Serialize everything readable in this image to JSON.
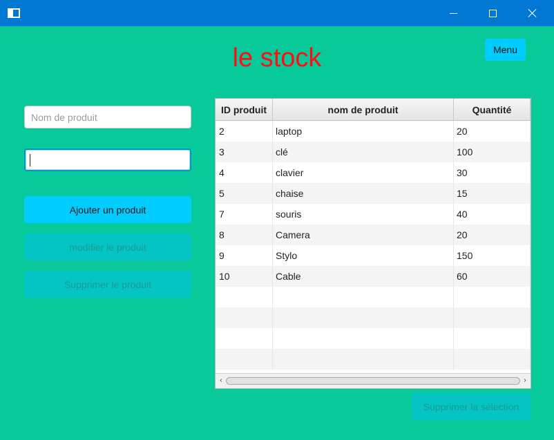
{
  "window": {
    "app_icon": "app-window-icon",
    "controls": [
      "minimize-icon",
      "maximize-icon",
      "close-icon"
    ]
  },
  "header": {
    "title": "le stock",
    "menu_label": "Menu"
  },
  "form": {
    "name_placeholder": "Nom de produit",
    "quantity_value": "",
    "add_label": "Ajouter un produit",
    "edit_label": "modifier le produit",
    "delete_label": "Supprimer le produit"
  },
  "table": {
    "columns": [
      "ID produit",
      "nom de produit",
      "Quantité"
    ],
    "rows": [
      [
        "2",
        "laptop",
        "20"
      ],
      [
        "3",
        "clé",
        "100"
      ],
      [
        "4",
        "clavier",
        "30"
      ],
      [
        "5",
        "chaise",
        "15"
      ],
      [
        "7",
        "souris",
        "40"
      ],
      [
        "8",
        "Camera",
        "20"
      ],
      [
        "9",
        "Stylo",
        "150"
      ],
      [
        "10",
        "Cable",
        "60"
      ],
      [
        "",
        "",
        ""
      ],
      [
        "",
        "",
        ""
      ],
      [
        "",
        "",
        ""
      ],
      [
        "",
        "",
        ""
      ]
    ]
  },
  "footer": {
    "delete_selection_label": "Supprimer la sélection"
  },
  "colors": {
    "background": "#07c99a",
    "titlebar": "#0078d4",
    "title_text": "#ff1010",
    "primary_button": "#00ccff",
    "disabled_button": "#05c5c4"
  }
}
